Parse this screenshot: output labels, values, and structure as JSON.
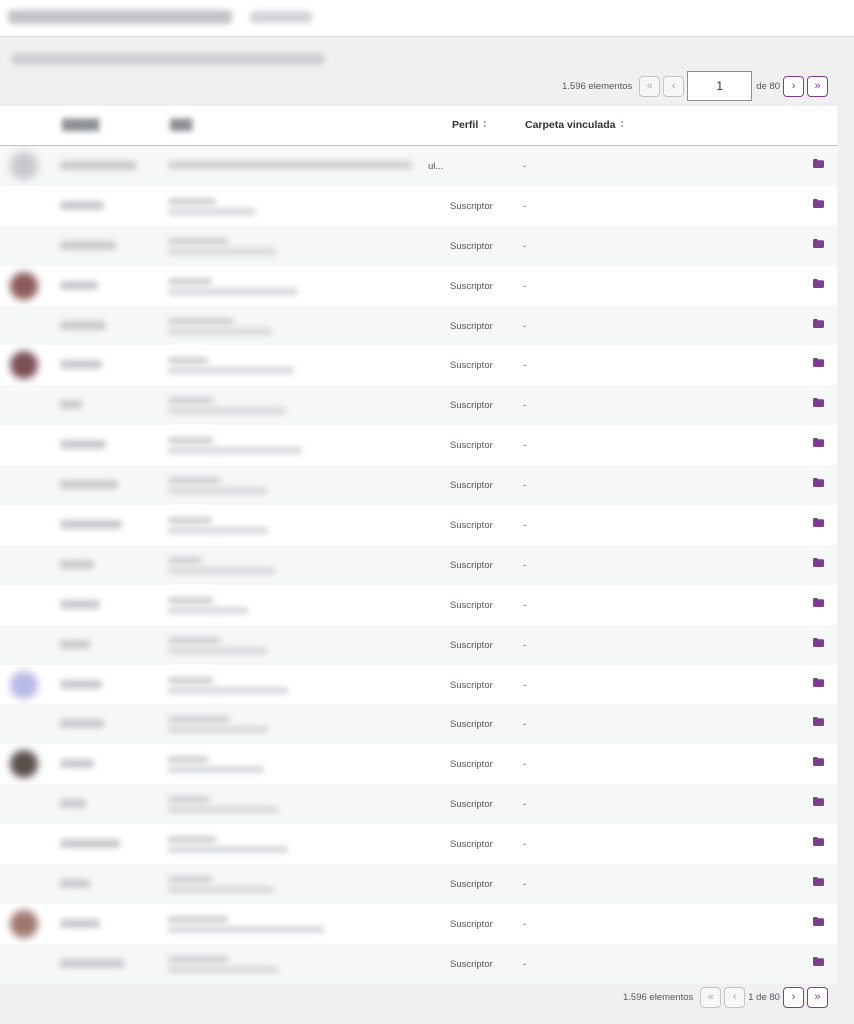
{
  "pagination": {
    "count_label": "1.596 elementos",
    "current_page": "1",
    "of_label": "de 80",
    "bottom_page_label": "1 de 80",
    "first_glyph": "«",
    "prev_glyph": "‹",
    "next_glyph": "›",
    "last_glyph": "»"
  },
  "columns": {
    "perfil": "Perfil",
    "carpeta": "Carpeta vinculada"
  },
  "first_row": {
    "name_trunc": "ul...",
    "carpeta": "-"
  },
  "rows": [
    {
      "perfil": "Suscriptor",
      "carpeta": "-"
    },
    {
      "perfil": "Suscriptor",
      "carpeta": "-"
    },
    {
      "perfil": "Suscriptor",
      "carpeta": "-"
    },
    {
      "perfil": "Suscriptor",
      "carpeta": "-"
    },
    {
      "perfil": "Suscriptor",
      "carpeta": "-"
    },
    {
      "perfil": "Suscriptor",
      "carpeta": "-"
    },
    {
      "perfil": "Suscriptor",
      "carpeta": "-"
    },
    {
      "perfil": "Suscriptor",
      "carpeta": "-"
    },
    {
      "perfil": "Suscriptor",
      "carpeta": "-"
    },
    {
      "perfil": "Suscriptor",
      "carpeta": "-"
    },
    {
      "perfil": "Suscriptor",
      "carpeta": "-"
    },
    {
      "perfil": "Suscriptor",
      "carpeta": "-"
    },
    {
      "perfil": "Suscriptor",
      "carpeta": "-"
    },
    {
      "perfil": "Suscriptor",
      "carpeta": "-"
    },
    {
      "perfil": "Suscriptor",
      "carpeta": "-"
    },
    {
      "perfil": "Suscriptor",
      "carpeta": "-"
    },
    {
      "perfil": "Suscriptor",
      "carpeta": "-"
    },
    {
      "perfil": "Suscriptor",
      "carpeta": "-"
    },
    {
      "perfil": "Suscriptor",
      "carpeta": "-"
    },
    {
      "perfil": "Suscriptor",
      "carpeta": "-"
    }
  ],
  "icons": {
    "folder": "folder-icon",
    "sort": "sort-arrows-icon"
  },
  "colors": {
    "accent": "#7e3f8f",
    "folder": "#7e3f8f",
    "row_alt": "#f6f7f7"
  }
}
